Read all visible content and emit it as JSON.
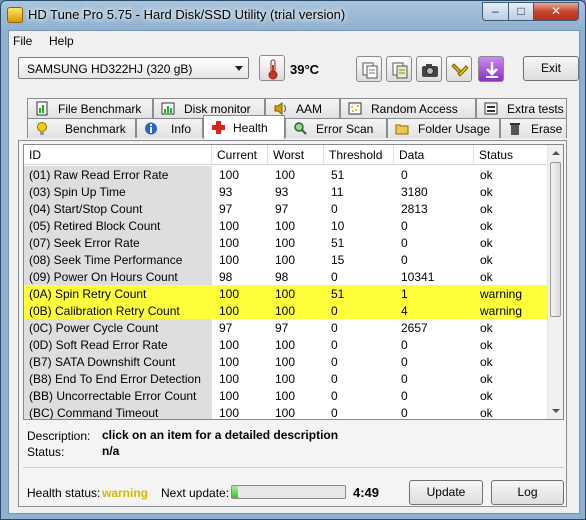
{
  "window": {
    "title": "HD Tune Pro 5.75 - Hard Disk/SSD Utility (trial version)"
  },
  "titlebar_buttons": {
    "minimize": "–",
    "maximize": "□",
    "close": "✕"
  },
  "menu": {
    "items": [
      "File",
      "Help"
    ]
  },
  "toolbar": {
    "drive": "SAMSUNG HD322HJ (320 gB)",
    "temperature": "39°C",
    "exit_label": "Exit",
    "icons": [
      "copy-info-icon",
      "copy-text-icon",
      "screenshot-camera-icon",
      "options-icon",
      "save-down-icon"
    ]
  },
  "tabs": {
    "row1": [
      {
        "label": "File Benchmark",
        "icon": "file-benchmark-icon"
      },
      {
        "label": "Disk monitor",
        "icon": "disk-monitor-icon"
      },
      {
        "label": "AAM",
        "icon": "speaker-icon"
      },
      {
        "label": "Random Access",
        "icon": "random-access-icon"
      },
      {
        "label": "Extra tests",
        "icon": "extra-tests-icon"
      }
    ],
    "row2": [
      {
        "label": "Benchmark",
        "icon": "benchmark-bulb-icon"
      },
      {
        "label": "Info",
        "icon": "info-icon"
      },
      {
        "label": "Health",
        "icon": "health-cross-icon",
        "active": true
      },
      {
        "label": "Error Scan",
        "icon": "error-scan-icon"
      },
      {
        "label": "Folder Usage",
        "icon": "folder-icon"
      },
      {
        "label": "Erase",
        "icon": "erase-trash-icon"
      }
    ]
  },
  "health_table": {
    "columns": [
      "ID",
      "Current",
      "Worst",
      "Threshold",
      "Data",
      "Status"
    ],
    "rows": [
      {
        "id": "(01) Raw Read Error Rate",
        "current": "100",
        "worst": "100",
        "threshold": "51",
        "data": "0",
        "status": "ok"
      },
      {
        "id": "(03) Spin Up Time",
        "current": "93",
        "worst": "93",
        "threshold": "11",
        "data": "3180",
        "status": "ok"
      },
      {
        "id": "(04) Start/Stop Count",
        "current": "97",
        "worst": "97",
        "threshold": "0",
        "data": "2813",
        "status": "ok"
      },
      {
        "id": "(05) Retired Block Count",
        "current": "100",
        "worst": "100",
        "threshold": "10",
        "data": "0",
        "status": "ok"
      },
      {
        "id": "(07) Seek Error Rate",
        "current": "100",
        "worst": "100",
        "threshold": "51",
        "data": "0",
        "status": "ok"
      },
      {
        "id": "(08) Seek Time Performance",
        "current": "100",
        "worst": "100",
        "threshold": "15",
        "data": "0",
        "status": "ok"
      },
      {
        "id": "(09) Power On Hours Count",
        "current": "98",
        "worst": "98",
        "threshold": "0",
        "data": "10341",
        "status": "ok"
      },
      {
        "id": "(0A) Spin Retry Count",
        "current": "100",
        "worst": "100",
        "threshold": "51",
        "data": "1",
        "status": "warning",
        "warn": true
      },
      {
        "id": "(0B) Calibration Retry Count",
        "current": "100",
        "worst": "100",
        "threshold": "0",
        "data": "4",
        "status": "warning",
        "warn": true
      },
      {
        "id": "(0C) Power Cycle Count",
        "current": "97",
        "worst": "97",
        "threshold": "0",
        "data": "2657",
        "status": "ok"
      },
      {
        "id": "(0D) Soft Read Error Rate",
        "current": "100",
        "worst": "100",
        "threshold": "0",
        "data": "0",
        "status": "ok"
      },
      {
        "id": "(B7) SATA Downshift Count",
        "current": "100",
        "worst": "100",
        "threshold": "0",
        "data": "0",
        "status": "ok"
      },
      {
        "id": "(B8) End To End Error Detection",
        "current": "100",
        "worst": "100",
        "threshold": "0",
        "data": "0",
        "status": "ok"
      },
      {
        "id": "(BB) Uncorrectable Error Count",
        "current": "100",
        "worst": "100",
        "threshold": "0",
        "data": "0",
        "status": "ok"
      },
      {
        "id": "(BC) Command Timeout",
        "current": "100",
        "worst": "100",
        "threshold": "0",
        "data": "0",
        "status": "ok"
      }
    ]
  },
  "description": {
    "desc_label": "Description:",
    "desc_value": "click on an item for a detailed description",
    "status_label": "Status:",
    "status_value": "n/a"
  },
  "footer": {
    "health_label": "Health status:",
    "health_value": "warning",
    "next_update_label": "Next update:",
    "next_update_progress": 0.05,
    "time": "4:49",
    "update_label": "Update",
    "log_label": "Log"
  },
  "colors": {
    "warning_row": "#ffff3c",
    "warning_text": "#d4b800",
    "progress": "#37c32a"
  }
}
